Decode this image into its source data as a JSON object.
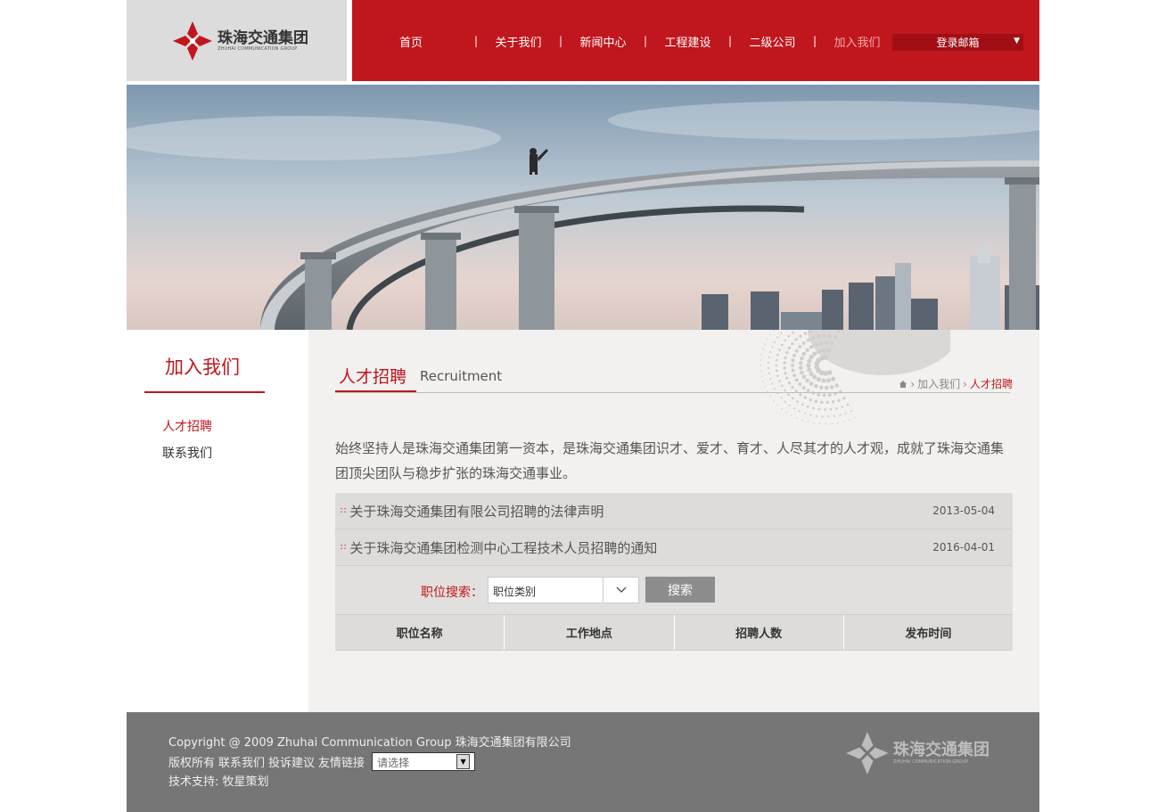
{
  "header": {
    "logo_cn": "珠海交通集团",
    "logo_en": "ZHUHAI COMMUNICATION GROUP",
    "nav": [
      "首页",
      "关于我们",
      "新闻中心",
      "工程建设",
      "二级公司",
      "加入我们"
    ],
    "nav_sep": "|",
    "mail_label": "登录邮箱",
    "mail_arrow": "▼"
  },
  "left": {
    "title": "加入我们",
    "links": [
      "人才招聘",
      "联系我们"
    ]
  },
  "main": {
    "title": "人才招聘",
    "subtitle": "Recruitment",
    "breadcrumb": [
      "加入我们",
      "人才招聘"
    ],
    "intro": "始终坚持人是珠海交通集团第一资本，是珠海交通集团识才、爱才、育才、人尽其才的人才观，成就了珠海交通集团顶尖团队与稳步扩张的珠海交通事业。",
    "news": [
      {
        "title": "关于珠海交通集团有限公司招聘的法律声明",
        "date": "2013-05-04"
      },
      {
        "title": "关于珠海交通集团检测中心工程技术人员招聘的通知",
        "date": "2016-04-01"
      }
    ],
    "search_label": "职位搜索：",
    "search_select": "职位类别",
    "search_button": "搜索",
    "table_headers": [
      "职位名称",
      "工作地点",
      "招聘人数",
      "发布时间"
    ]
  },
  "footer": {
    "copyright": "Copyright @ 2009 Zhuhai Communication Group 珠海交通集团有限公司",
    "links": [
      "版权所有",
      "联系我们",
      "投诉建议",
      "友情链接"
    ],
    "select_placeholder": "请选择",
    "support": "技术支持: 牧星策划",
    "logo_cn": "珠海交通集团",
    "logo_en": "ZHUHAI COMMUNICATION GROUP"
  },
  "colors": {
    "brand_red": "#c0161d",
    "footer_gray": "#767676"
  }
}
